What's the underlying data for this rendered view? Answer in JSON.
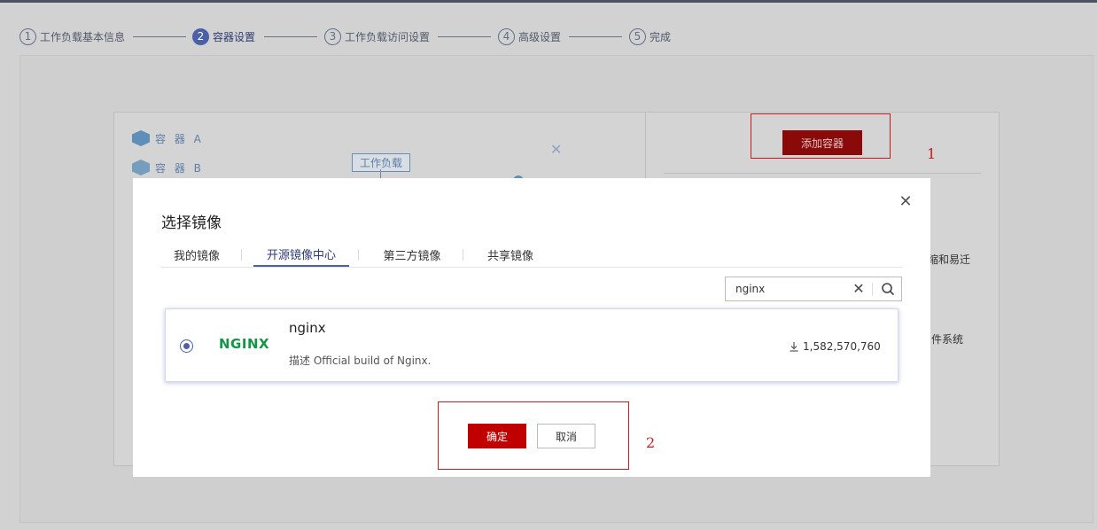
{
  "steps": [
    {
      "num": "1",
      "label": "工作负载基本信息"
    },
    {
      "num": "2",
      "label": "容器设置"
    },
    {
      "num": "3",
      "label": "工作负载访问设置"
    },
    {
      "num": "4",
      "label": "高级设置"
    },
    {
      "num": "5",
      "label": "完成"
    }
  ],
  "background": {
    "container_a": "容 器 A",
    "container_b": "容 器 B",
    "workload_tag": "工作负载",
    "add_container_button": "添加容器",
    "right_text_1": "缩和易迁",
    "right_text_2": "件系统"
  },
  "annotations": {
    "marker_1": "1",
    "marker_2": "2",
    "color": "#c81a1a"
  },
  "modal": {
    "title": "选择镜像",
    "close_icon": "close-icon",
    "tabs": [
      {
        "label": "我的镜像"
      },
      {
        "label": "开源镜像中心",
        "active": true
      },
      {
        "label": "第三方镜像"
      },
      {
        "label": "共享镜像"
      }
    ],
    "search": {
      "value": "nginx"
    },
    "image": {
      "logo": "NGINX",
      "name": "nginx",
      "description": "描述 Official build of Nginx.",
      "downloads": "1,582,570,760"
    },
    "confirm_label": "确定",
    "cancel_label": "取消"
  },
  "colors": {
    "accent": "#4a60a8",
    "primary_button": "#c00000",
    "logo_green": "#149447"
  }
}
